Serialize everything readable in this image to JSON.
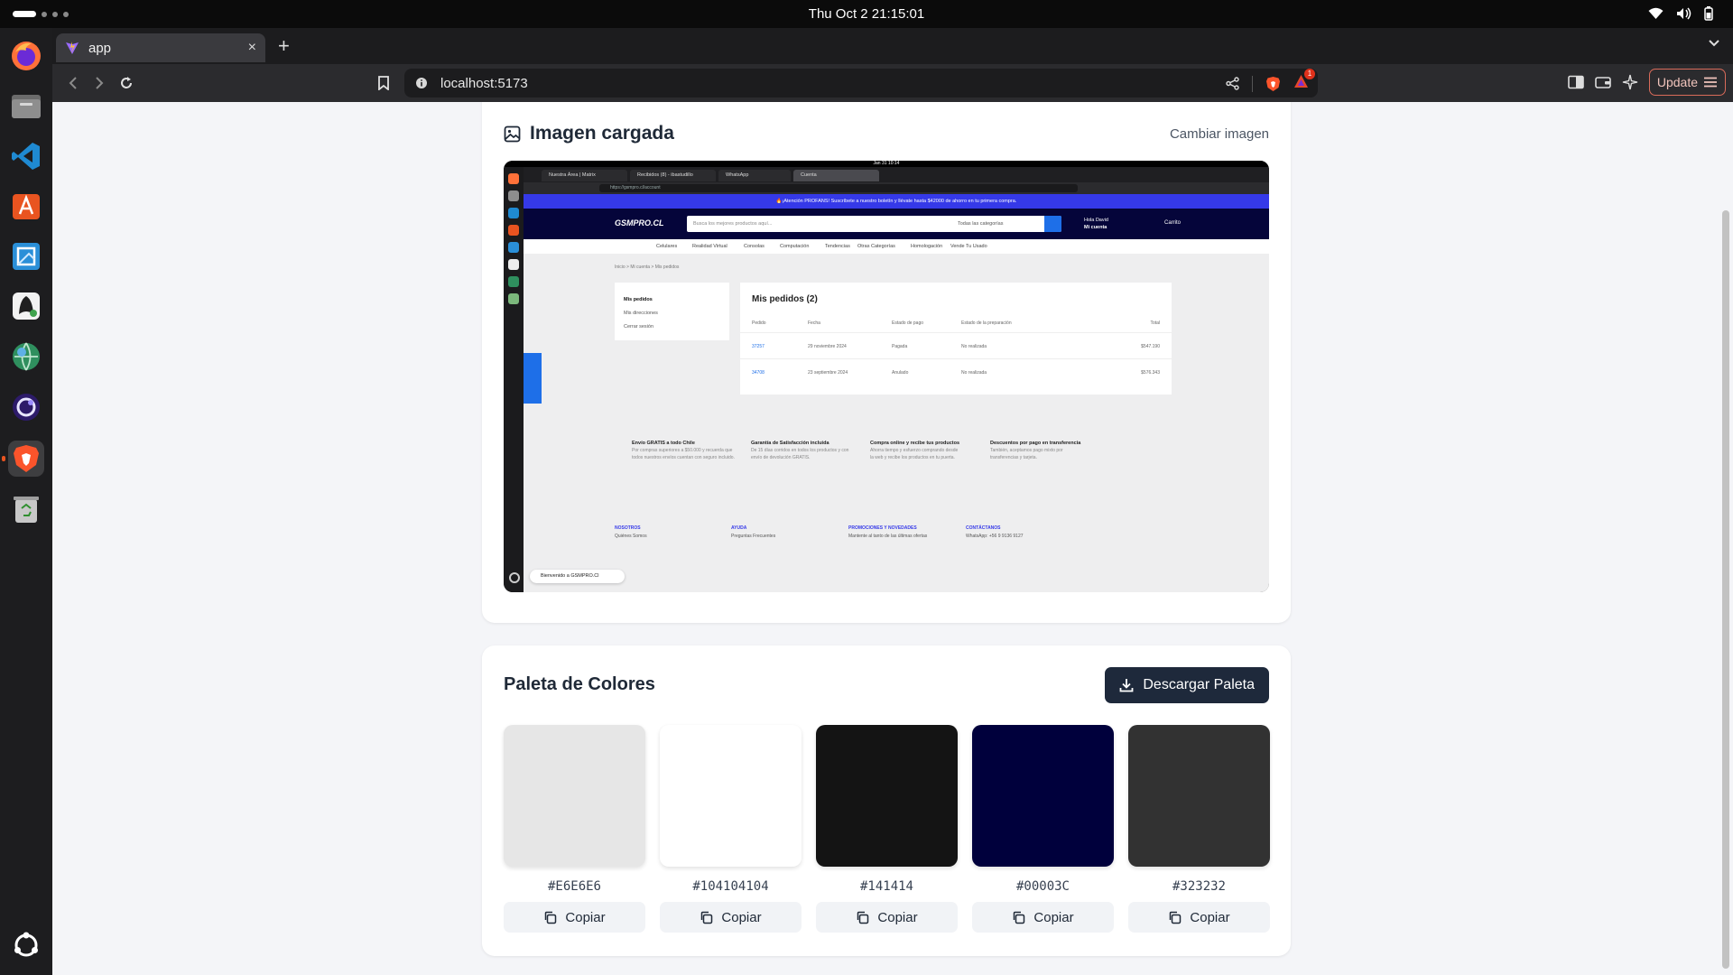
{
  "system": {
    "clock": "Thu Oct 2  21:15:01"
  },
  "browser": {
    "tab_title": "app",
    "tab_close": "×",
    "new_tab": "+",
    "url": "localhost:5173",
    "update_label": "Update",
    "brave_badge_count": "1"
  },
  "image_card": {
    "title": "Imagen cargada",
    "change_link": "Cambiar imagen"
  },
  "preview": {
    "clock": "Jan 31  10:14",
    "tabs": [
      "Nuestra Área | Matrix",
      "Recibidos (8) - ibastudillo",
      "WhatsApp",
      "Cuenta"
    ],
    "url": "https://gsmpro.cl/account",
    "banner": "🔥¡Atención PROFANS! Suscríbete a nuestro boletín y llévate hasta $42000 de ahorro en tu primera compra.",
    "logo": "GSMPRO.CL",
    "search_placeholder": "Busca los mejores productos aquí...",
    "search_category": "Todas las categorías",
    "greeting": "Hola David",
    "account": "Mi cuenta",
    "cart": "Carrito",
    "menu": [
      "Celulares",
      "Realidad Virtual",
      "Consolas",
      "Computación",
      "Tendencias",
      "Otras Categorías",
      "Homologación",
      "Vende Tu Usado"
    ],
    "breadcrumb": "Inicio  >  Mi cuenta  >  Mis pedidos",
    "side_menu": [
      "Mis pedidos",
      "Mis direcciones",
      "Cerrar sesión"
    ],
    "orders_title": "Mis pedidos (2)",
    "orders_headers": [
      "Pedido",
      "Fecha",
      "Estado de pago",
      "Estado de la preparación",
      "Total"
    ],
    "orders_rows": [
      [
        "37257",
        "29 noviembre 2024",
        "Pagada",
        "No realizada",
        "$547.190"
      ],
      [
        "34708",
        "23 septiembre 2024",
        "Anulado",
        "No realizada",
        "$576.343"
      ]
    ],
    "features": [
      {
        "title": "Envío GRATIS a todo Chile",
        "text": "Por compras superiores a $50.000 y recuerda que todos nuestros envíos cuentan con seguro incluido."
      },
      {
        "title": "Garantía de Satisfacción incluida",
        "text": "De 15 días corridos en todos los productos y con envío de devolución GRATIS."
      },
      {
        "title": "Compra online y recibe tus productos",
        "text": "Ahorra tiempo y esfuerzo comprando desde la web y recibe los productos en tu puerta."
      },
      {
        "title": "Descuentos por pago en transferencia",
        "text": "También, aceptamos pago mixto por transferencias y tarjeta."
      }
    ],
    "footer": [
      {
        "title": "NOSOTROS",
        "text": "Quiénes Somos"
      },
      {
        "title": "AYUDA",
        "text": "Preguntas Frecuentes"
      },
      {
        "title": "PROMOCIONES Y NOVEDADES",
        "text": "Mantente al tanto de las últimas ofertas"
      },
      {
        "title": "CONTÁCTANOS",
        "text": "WhatsApp: +56 9 9136 9127"
      }
    ],
    "toast": "Bienvenido a GSMPRO.Cl"
  },
  "palette_card": {
    "title": "Paleta de Colores",
    "download_label": "Descargar Paleta",
    "copy_label": "Copiar",
    "swatches": [
      {
        "hex": "#E6E6E6",
        "color": "#e6e6e6"
      },
      {
        "hex": "#104104104",
        "color": "#ffffff"
      },
      {
        "hex": "#141414",
        "color": "#141414"
      },
      {
        "hex": "#00003C",
        "color": "#00003c"
      },
      {
        "hex": "#323232",
        "color": "#323232"
      }
    ]
  }
}
